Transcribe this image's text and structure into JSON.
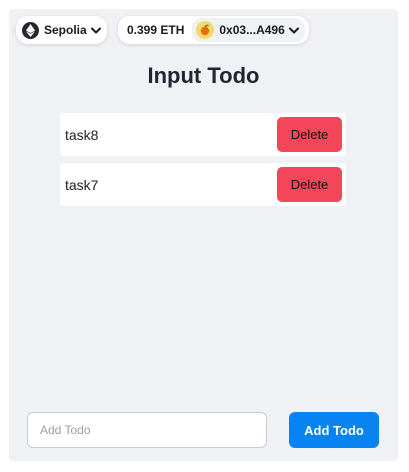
{
  "wallet": {
    "network": {
      "label": "Sepolia",
      "icon": "ethereum-icon"
    },
    "balance": "0.399 ETH",
    "address": "0x03...A496",
    "avatar_icon": "fruit-avatar-icon",
    "chevron_icon": "chevron-down-icon"
  },
  "page": {
    "title": "Input Todo"
  },
  "todos": [
    {
      "text": "task8",
      "delete_label": "Delete"
    },
    {
      "text": "task7",
      "delete_label": "Delete"
    }
  ],
  "add_form": {
    "placeholder": "Add Todo",
    "value": "",
    "button_label": "Add Todo"
  },
  "colors": {
    "panel_bg": "#f0f1f5",
    "delete_button": "#f4465a",
    "add_button": "#0784f2",
    "title_text": "#1f2630"
  }
}
